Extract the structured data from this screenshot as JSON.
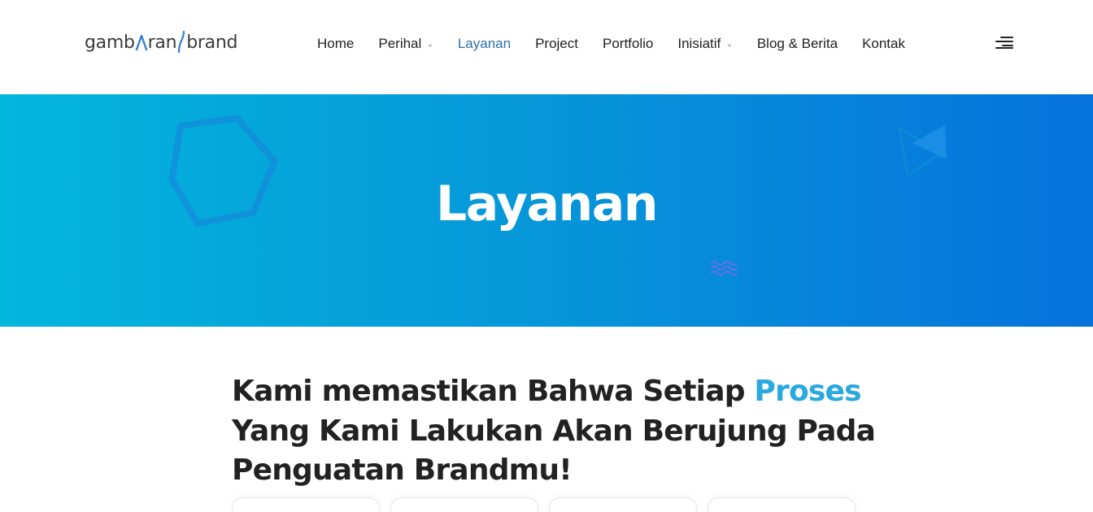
{
  "logo": {
    "text_left": "gamb",
    "text_mid": "ran",
    "text_right": "brand"
  },
  "nav": {
    "items": [
      {
        "label": "Home",
        "dropdown": false,
        "active": false
      },
      {
        "label": "Perihal",
        "dropdown": true,
        "active": false
      },
      {
        "label": "Layanan",
        "dropdown": false,
        "active": true
      },
      {
        "label": "Project",
        "dropdown": false,
        "active": false
      },
      {
        "label": "Portfolio",
        "dropdown": false,
        "active": false
      },
      {
        "label": "Inisiatif",
        "dropdown": true,
        "active": false
      },
      {
        "label": "Blog & Berita",
        "dropdown": false,
        "active": false
      },
      {
        "label": "Kontak",
        "dropdown": false,
        "active": false
      }
    ],
    "active_color": "#2f6fb3"
  },
  "hero": {
    "title": "Layanan",
    "gradient": [
      "#03b6dc",
      "#0696d9",
      "#0672dc"
    ]
  },
  "main": {
    "heading_before": "Kami memastikan Bahwa Setiap ",
    "heading_highlight": "Proses",
    "heading_after": " Yang Kami Lakukan Akan Berujung Pada Penguatan Brandmu!",
    "highlight_color": "#29a9e0"
  },
  "icons": {
    "menu": "menu-lines-icon",
    "hexagon": "hexagon-outline-icon",
    "triangle": "triangle-arrow-icon",
    "wave": "wave-lines-icon"
  }
}
